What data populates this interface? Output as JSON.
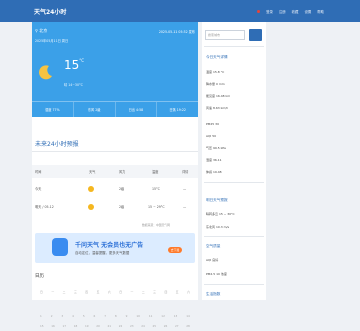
{
  "header": {
    "logo": "天气24小时",
    "nav": [
      "登录",
      "注册",
      "收藏",
      "设置",
      "帮助"
    ]
  },
  "weather": {
    "location": "北京",
    "date": "2025年05月11日 周日",
    "updated": "2025-05-11 05:32 发布",
    "temp": "15",
    "unit": "°C",
    "range": "晴  14~30°C",
    "stats": [
      "湿度 77%",
      "东风 2级",
      "日出 4:58",
      "日落 19:22"
    ]
  },
  "hourly": {
    "title": "未来24小时预报",
    "head": [
      "时间",
      "天气",
      "",
      "风力",
      "温度",
      "详情"
    ],
    "rows": [
      {
        "time": "今天",
        "wind": "2级",
        "temp": "15°C",
        "more": "—"
      },
      {
        "time": "明天 / 05-12",
        "wind": "2级",
        "temp": "15 ~ 29°C",
        "more": "—"
      }
    ],
    "note": "数据来源：中国天气网"
  },
  "ad": {
    "title": "千问天气  无会员也无广告",
    "subtitle": "自动定位，温馨提醒，更多天气数据",
    "button": "去下载"
  },
  "calendar": {
    "title": "日历",
    "row1": [
      "日",
      "一",
      "二",
      "三",
      "四",
      "五",
      "六",
      "日",
      "一",
      "二",
      "三",
      "四",
      "五",
      "六"
    ],
    "row2": [
      "1",
      "2",
      "3",
      "4",
      "5",
      "6",
      "7",
      "8",
      "9",
      "10",
      "11",
      "12",
      "13",
      "14"
    ],
    "row3": [
      "15",
      "16",
      "17",
      "18",
      "19",
      "20",
      "21",
      "22",
      "23",
      "24",
      "25",
      "26",
      "27",
      "28"
    ]
  },
  "side": {
    "search_placeholder": "搜索城市",
    "block1_title": "今日天气详情",
    "block1": [
      "温度 15.8 °C",
      "降水量 0 mm",
      "能见度 16.48 km",
      "风速 8.63 km/h",
      "PM25 30",
      "AQI 50",
      "气压 99.5 kPa",
      "湿度 36.11",
      "体感 19.48"
    ],
    "block2_title": "明日天气预报",
    "block2": [
      "晴转多云 15 ~ 30°C",
      "东北风 10.3 m/s"
    ],
    "block3_title": "空气质量",
    "block3": [
      "AQI 良好",
      "PM2.5 10 浓度"
    ],
    "block4_title": "生活指数"
  },
  "colors": {
    "header": "#2f6db5",
    "weather_bg": "#3ba0e8",
    "ad_bg": "#dcecff",
    "accent": "#ff7a2a"
  }
}
